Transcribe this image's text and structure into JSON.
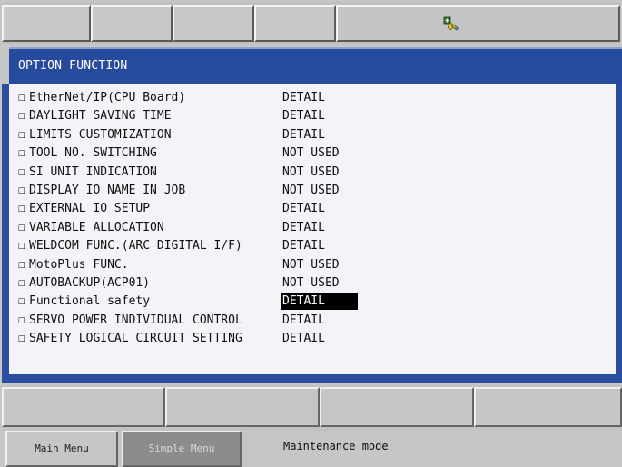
{
  "title": "OPTION FUNCTION",
  "checkbox_glyph": "☐",
  "items": [
    {
      "name": "EtherNet/IP(CPU Board)",
      "value": "DETAIL"
    },
    {
      "name": "DAYLIGHT SAVING TIME",
      "value": "DETAIL"
    },
    {
      "name": "LIMITS CUSTOMIZATION",
      "value": "DETAIL"
    },
    {
      "name": "TOOL NO. SWITCHING",
      "value": "NOT USED"
    },
    {
      "name": "SI UNIT INDICATION",
      "value": "NOT USED"
    },
    {
      "name": "DISPLAY IO NAME IN JOB",
      "value": "NOT USED"
    },
    {
      "name": "EXTERNAL IO SETUP",
      "value": "DETAIL"
    },
    {
      "name": "VARIABLE ALLOCATION",
      "value": "DETAIL"
    },
    {
      "name": "WELDCOM FUNC.(ARC DIGITAL I/F)",
      "value": "DETAIL"
    },
    {
      "name": "MotoPlus FUNC.",
      "value": "NOT USED"
    },
    {
      "name": "AUTOBACKUP(ACP01)",
      "value": "NOT USED"
    },
    {
      "name": "Functional safety",
      "value": "DETAIL"
    },
    {
      "name": "SERVO POWER INDIVIDUAL CONTROL",
      "value": "DETAIL"
    },
    {
      "name": "SAFETY LOGICAL CIRCUIT SETTING",
      "value": "DETAIL"
    }
  ],
  "selected_index": 11,
  "status": {
    "main_menu": "Main Menu",
    "simple_menu": "Simple Menu",
    "mode": "Maintenance mode"
  },
  "top_icon": "key-edit-icon",
  "colors": {
    "title_bar": "#274b9c",
    "selection_bg": "#000000",
    "selection_fg": "#ffffff"
  }
}
